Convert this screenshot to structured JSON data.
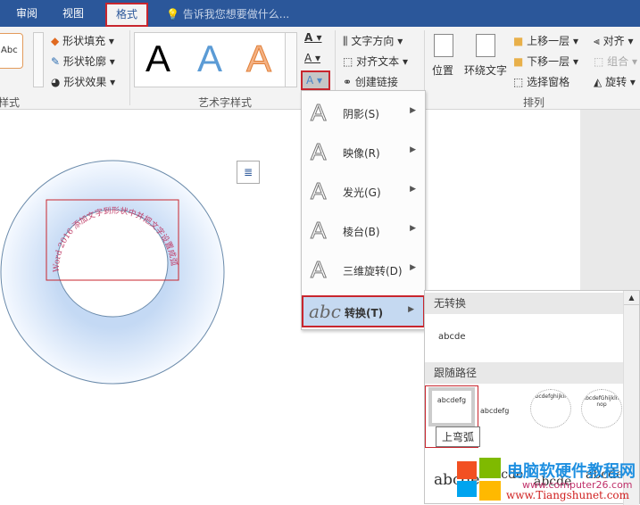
{
  "tabs": [
    "审阅",
    "视图",
    "格式"
  ],
  "tell_me": "告诉我您想要做什么...",
  "ribbon": {
    "shape_styles": {
      "label": "样式",
      "preview": "Abc",
      "fill": "形状填充",
      "outline": "形状轮廓",
      "effects": "形状效果"
    },
    "wordart": {
      "label": "艺术字样式",
      "glyph": "A"
    },
    "text": {
      "direction": "文字方向",
      "align": "对齐文本",
      "link": "创建链接"
    },
    "arrange": {
      "label": "排列",
      "position": "位置",
      "wrap": "环绕文字",
      "forward": "上移一层",
      "backward": "下移一层",
      "pane": "选择窗格",
      "align": "对齐",
      "group": "组合",
      "rotate": "旋转"
    }
  },
  "menu": {
    "items": [
      {
        "label": "阴影(S)"
      },
      {
        "label": "映像(R)"
      },
      {
        "label": "发光(G)"
      },
      {
        "label": "棱台(B)"
      },
      {
        "label": "三维旋转(D)"
      },
      {
        "label": "转换(T)",
        "icon": "abc"
      }
    ]
  },
  "panel": {
    "no_transform": "无转换",
    "sample": "abcde",
    "follow_path": "跟随路径",
    "path_samples": [
      "abcdefg",
      "abcdefg",
      "abcdefghijklm",
      "abcdefGhijklmnop"
    ],
    "tooltip": "上弯弧",
    "warp_samples": [
      "abcde",
      "abcde",
      "abcde",
      "abcde"
    ]
  },
  "document": {
    "arc_text": "Word 2016 添加文字到形状中并把文字设置成弧形"
  },
  "watermark": {
    "title": "电脑软硬件教程网",
    "url1": "www.computer26.com",
    "url2": "www.Tiangshunet.com"
  },
  "colors": {
    "accent": "#2b579a",
    "highlight": "#c8262e"
  }
}
